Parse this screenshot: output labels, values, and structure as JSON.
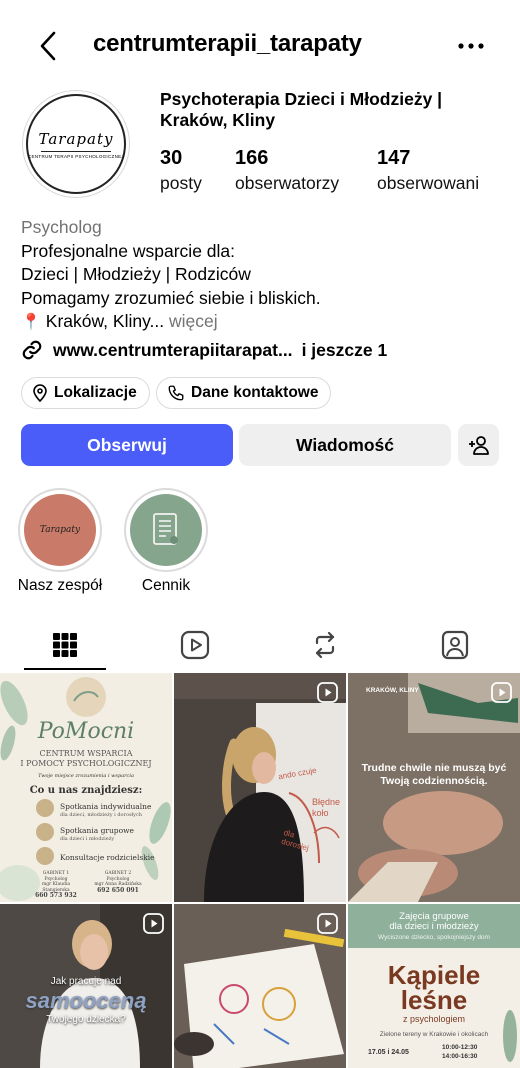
{
  "header": {
    "username": "centrumterapii_tarapaty",
    "back_icon": "chevron-left-icon",
    "more_icon": "more-horizontal-icon"
  },
  "avatar": {
    "logo_text": "Tarapaty",
    "logo_sub": "CENTRUM TERAPII PSYCHOLOGICZNEJ"
  },
  "profile": {
    "display_name": "Psychoterapia Dzieci i Młodzieży | Kraków, Kliny",
    "stats": [
      {
        "value": "30",
        "label": "posty"
      },
      {
        "value": "166",
        "label": "obserwatorzy"
      },
      {
        "value": "147",
        "label": "obserwowani"
      }
    ],
    "category": "Psycholog",
    "bio_lines": [
      "Profesjonalne wsparcie dla:",
      "Dzieci | Młodzieży | Rodziców",
      "Pomagamy zrozumieć siebie i bliskich."
    ],
    "location_text": "Kraków, Kliny...",
    "more_label": "więcej",
    "link": "www.centrumterapiitarapat...",
    "link_extra": "i jeszcze 1"
  },
  "chips": {
    "location": "Lokalizacje",
    "contact": "Dane kontaktowe"
  },
  "buttons": {
    "follow": "Obserwuj",
    "message": "Wiadomość"
  },
  "highlights": [
    {
      "label": "Nasz zespół",
      "color": "#c97a68",
      "inner_text": "Tarapaty"
    },
    {
      "label": "Cennik",
      "color": "#86a58d"
    }
  ],
  "tabs": [
    "grid-icon",
    "reels-icon",
    "reposts-icon",
    "tagged-icon"
  ],
  "posts": {
    "p1": {
      "title": "PoMocni",
      "subtitle1": "CENTRUM WSPARCIA",
      "subtitle2": "I POMOCY PSYCHOLOGICZNEJ",
      "tagline": "Twoje miejsce zrozumienia i wsparcia",
      "heading": "Co u nas znajdziesz:",
      "items": [
        {
          "title": "Spotkania indywidualne",
          "sub": "dla dzieci, młodzieży i dorosłych"
        },
        {
          "title": "Spotkania grupowe",
          "sub": "dla dzieci i młodzieży"
        },
        {
          "title": "Konsultacje rodzicielskie",
          "sub": ""
        }
      ],
      "g1_title": "GABINET 1",
      "g1_role": "Psycholog",
      "g1_name": "mgr Klaudia Stangierska",
      "g1_phone": "660 573 932",
      "g2_title": "GABINET 2",
      "g2_role": "Psycholog",
      "g2_name": "mgr Anna Radzińska",
      "g2_phone": "692 650 091"
    },
    "p2": {
      "board_text1": "ando czuje",
      "board_text2": "Błędne koło",
      "board_text3": "dla dorosłej"
    },
    "p3": {
      "tag": "KRAKÓW, KLINY",
      "text": "Trudne chwile nie muszą być Twoją codziennością."
    },
    "p4": {
      "line1": "Jak pracuje nad",
      "line2": "samooceną",
      "line3": "Twojego dziecka?"
    },
    "p6": {
      "head1": "Zajęcia grupowe",
      "head2": "dla dzieci i młodzieży",
      "head3": "Wyciszone dziecko, spokojniejszy dom",
      "big1": "Kąpiele",
      "big2": "leśne",
      "sub": "z psychologiem",
      "place": "Zielone tereny w Krakowie i okolicach",
      "dates": "17.05 i 24.05",
      "time1": "10:00-12:30",
      "time2": "14:00-16:30"
    }
  }
}
